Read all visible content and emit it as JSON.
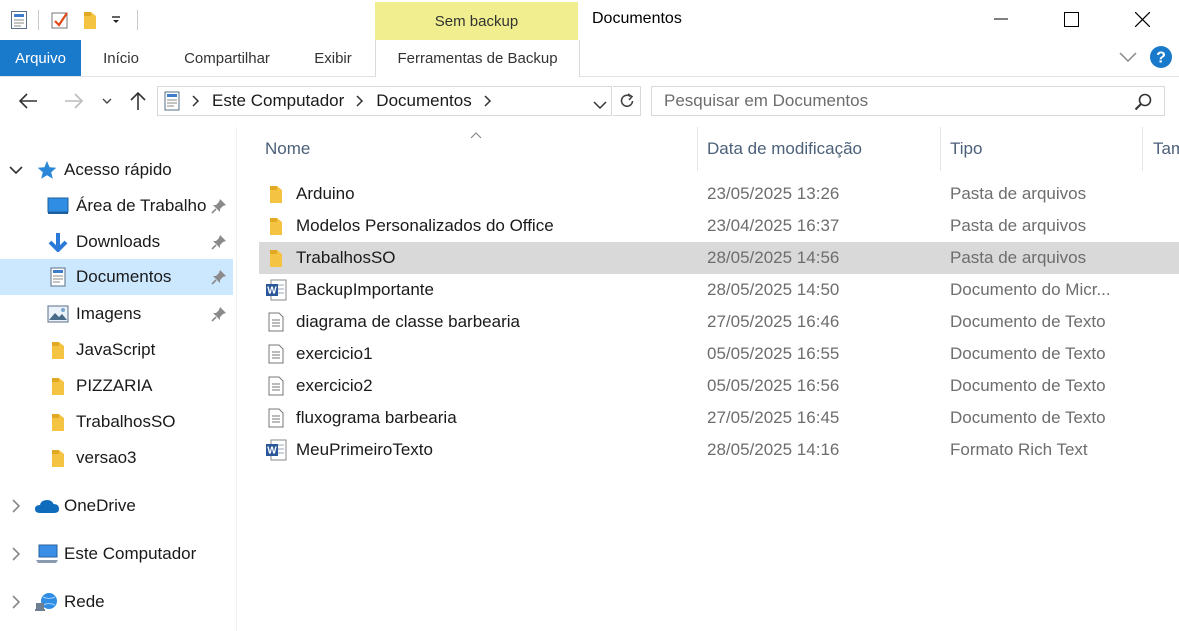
{
  "window": {
    "title": "Documentos",
    "contextual_tab_header": "Sem backup"
  },
  "ribbon": {
    "tabs": [
      "Arquivo",
      "Início",
      "Compartilhar",
      "Exibir",
      "Ferramentas de Backup"
    ]
  },
  "address": {
    "breadcrumb": [
      "Este Computador",
      "Documentos"
    ]
  },
  "search": {
    "placeholder": "Pesquisar em Documentos"
  },
  "nav_pane": {
    "quick_access": "Acesso rápido",
    "items": [
      {
        "label": "Área de Trabalho",
        "icon": "desktop-icon",
        "pinned": true
      },
      {
        "label": "Downloads",
        "icon": "downloads-icon",
        "pinned": true
      },
      {
        "label": "Documentos",
        "icon": "documents-icon",
        "pinned": true,
        "selected": true
      },
      {
        "label": "Imagens",
        "icon": "pictures-icon",
        "pinned": true
      },
      {
        "label": "JavaScript",
        "icon": "folder-icon"
      },
      {
        "label": "PIZZARIA",
        "icon": "folder-icon"
      },
      {
        "label": "TrabalhosSO",
        "icon": "folder-icon"
      },
      {
        "label": "versao3",
        "icon": "folder-icon"
      }
    ],
    "onedrive": "OneDrive",
    "this_pc": "Este Computador",
    "network": "Rede"
  },
  "file_list": {
    "columns": [
      "Nome",
      "Data de modificação",
      "Tipo",
      "Tam"
    ],
    "rows": [
      {
        "name": "Arduino",
        "date": "23/05/2025 13:26",
        "type": "Pasta de arquivos",
        "icon": "folder-icon"
      },
      {
        "name": "Modelos Personalizados do Office",
        "date": "23/04/2025 16:37",
        "type": "Pasta de arquivos",
        "icon": "folder-icon"
      },
      {
        "name": "TrabalhosSO",
        "date": "28/05/2025 14:56",
        "type": "Pasta de arquivos",
        "icon": "folder-icon",
        "selected": true
      },
      {
        "name": "BackupImportante",
        "date": "28/05/2025 14:50",
        "type": "Documento do Micr...",
        "icon": "word-icon"
      },
      {
        "name": "diagrama de classe barbearia",
        "date": "27/05/2025 16:46",
        "type": "Documento de Texto",
        "icon": "text-file-icon"
      },
      {
        "name": "exercicio1",
        "date": "05/05/2025 16:55",
        "type": "Documento de Texto",
        "icon": "text-file-icon"
      },
      {
        "name": "exercicio2",
        "date": "05/05/2025 16:56",
        "type": "Documento de Texto",
        "icon": "text-file-icon"
      },
      {
        "name": "fluxograma barbearia",
        "date": "27/05/2025 16:45",
        "type": "Documento de Texto",
        "icon": "text-file-icon"
      },
      {
        "name": "MeuPrimeiroTexto",
        "date": "28/05/2025 14:16",
        "type": "Formato Rich Text",
        "icon": "word-icon"
      }
    ]
  },
  "colors": {
    "file_tab": "#1979ca",
    "contextual_tab": "#f0ee8f",
    "nav_selected": "#cce8ff",
    "row_selected": "#d9d9d9",
    "help_badge": "#1979ca"
  }
}
